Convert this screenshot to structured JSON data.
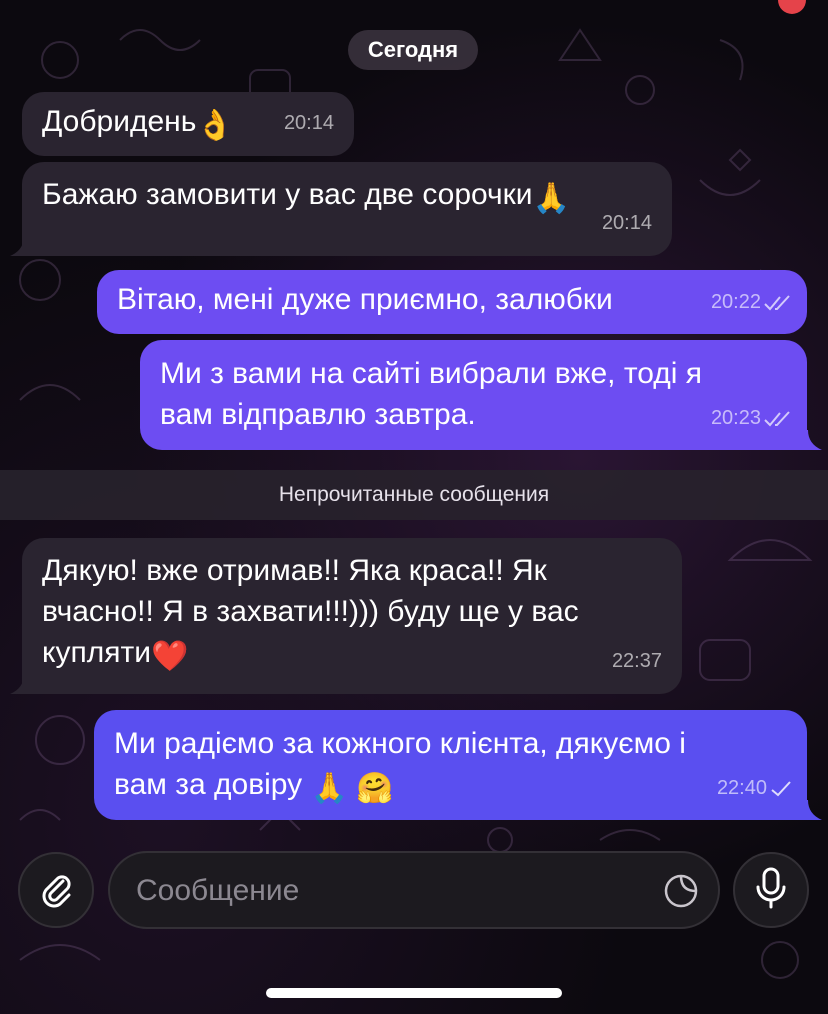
{
  "header": {
    "date_label": "Сегодня"
  },
  "messages": [
    {
      "dir": "in",
      "text": "Добридень",
      "emoji": "👌",
      "time": "20:14"
    },
    {
      "dir": "in",
      "text": "Бажаю замовити у вас две сорочки",
      "emoji": "🙏",
      "time": "20:14"
    },
    {
      "dir": "out",
      "text": "Вітаю, мені дуже приємно, залюбки",
      "time": "20:22",
      "status": "read"
    },
    {
      "dir": "out",
      "line1": "Ми з вами на сайті вибрали вже, тоді я",
      "line2": "вам відправлю завтра.",
      "time": "20:23",
      "status": "read"
    },
    {
      "dir": "in",
      "line1": "Дякую! вже отримав!! Яка краса!!  Як",
      "line2": "вчасно!! Я в захвати!!!))) буду ще у вас",
      "line3": "купляти",
      "emoji": "❤️",
      "time": "22:37"
    },
    {
      "dir": "out",
      "line1": "Ми радіємо за кожного клієнта, дякуємо і",
      "line2": "вам за довіру ",
      "emoji1": "🙏",
      "emoji2": "🤗",
      "time": "22:40",
      "status": "sent"
    }
  ],
  "unread_divider": "Непрочитанные сообщения",
  "composer": {
    "placeholder": "Сообщение",
    "attach_icon": "paperclip-icon",
    "sticker_icon": "sticker-icon",
    "mic_icon": "microphone-icon"
  },
  "colors": {
    "incoming_bubble": "#2a2430",
    "outgoing_bubble": "#6d4df2",
    "outgoing_bubble_last": "#5a4ff0",
    "background": "#0c090f"
  }
}
